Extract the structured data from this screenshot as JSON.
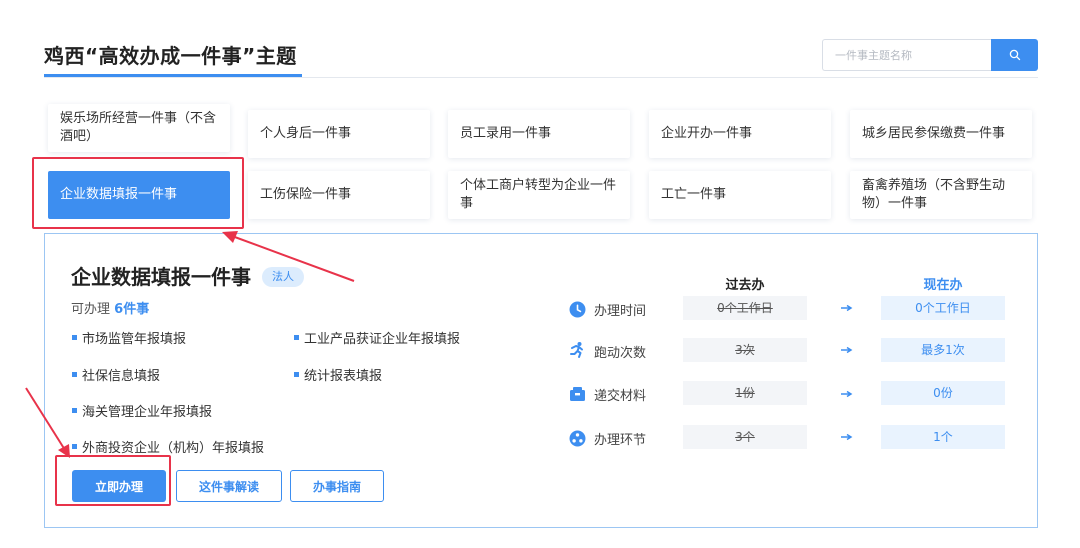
{
  "header": {
    "title": "鸡西“高效办成一件事”主题",
    "search_placeholder": "一件事主题名称"
  },
  "topics": [
    "娱乐场所经营一件事（不含酒吧）",
    "个人身后一件事",
    "员工录用一件事",
    "企业开办一件事",
    "城乡居民参保缴费一件事",
    "企业数据填报一件事",
    "工伤保险一件事",
    "个体工商户转型为企业一件事",
    "工亡一件事",
    "畜禽养殖场（不含野生动物）一件事"
  ],
  "detail": {
    "title": "企业数据填报一件事",
    "badge": "法人",
    "count_label": "可办理",
    "count_value": "6件事",
    "items": [
      "市场监管年报填报",
      "工业产品获证企业年报填报",
      "社保信息填报",
      "统计报表填报",
      "海关管理企业年报填报",
      "外商投资企业（机构）年报填报"
    ],
    "buttons": {
      "apply": "立即办理",
      "explain": "这件事解读",
      "guide": "办事指南"
    }
  },
  "comparison": {
    "past_header": "过去办",
    "now_header": "现在办",
    "rows": [
      {
        "icon": "clock-icon",
        "label": "办理时间",
        "past": "0个工作日",
        "now": "0个工作日"
      },
      {
        "icon": "running-icon",
        "label": "跑动次数",
        "past": "3次",
        "now": "最多1次"
      },
      {
        "icon": "folder-icon",
        "label": "递交材料",
        "past": "1份",
        "now": "0份"
      },
      {
        "icon": "process-icon",
        "label": "办理环节",
        "past": "3个",
        "now": "1个"
      }
    ]
  },
  "colors": {
    "accent": "#3d8ef0",
    "annotation": "#e8334a",
    "past_header": "#222222",
    "now_header": "#3d8ef0"
  }
}
